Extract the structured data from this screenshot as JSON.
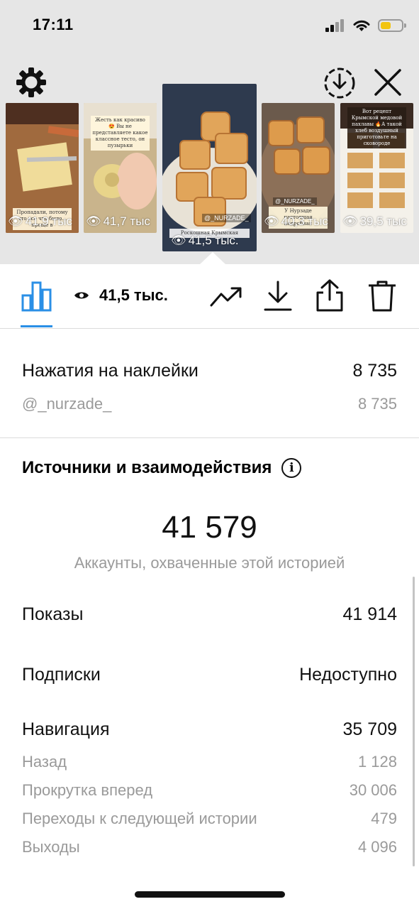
{
  "status_bar": {
    "time": "17:11"
  },
  "stories": [
    {
      "views": "41,9 тыс",
      "caption": "Пропадали, потому что все что было... проще в"
    },
    {
      "views": "41,7 тыс",
      "caption": "Жесть как красиво😍 Вы не представляете какое классное тесто, он пузырьки"
    },
    {
      "views": "41,5 тыс.",
      "sticker": "@_NURZADE_",
      "caption": "Роскошная Крымская",
      "selected": true
    },
    {
      "views": "40,3 тыс",
      "sticker": "@_NURZADE_",
      "caption": "У Нурзаде настоящая подробная"
    },
    {
      "views": "39,5 тыс",
      "caption": "Вот рецепт Крымской медовой пахлавы 🔥А такой хлеб воздушный приготовьте на сковороде"
    }
  ],
  "toolbar": {
    "views": "41,5 тыс."
  },
  "sticker_taps": {
    "label": "Нажатия на наклейки",
    "value": "8 735",
    "sub_label": "@_nurzade_",
    "sub_value": "8 735"
  },
  "discovery": {
    "title": "Источники и взаимодействия",
    "reach_value": "41 579",
    "reach_caption": "Аккаунты, охваченные этой историей",
    "impressions_label": "Показы",
    "impressions_value": "41 914",
    "follows_label": "Подписки",
    "follows_value": "Недоступно",
    "navigation_label": "Навигация",
    "navigation_value": "35 709",
    "nav_items": [
      {
        "label": "Назад",
        "value": "1 128"
      },
      {
        "label": "Прокрутка вперед",
        "value": "30 006"
      },
      {
        "label": "Переходы к следующей истории",
        "value": "479"
      },
      {
        "label": "Выходы",
        "value": "4 096"
      }
    ]
  },
  "colors": {
    "accent": "#2a8fe6",
    "battery": "#f2c40f",
    "muted_text": "#9a9a9a"
  }
}
